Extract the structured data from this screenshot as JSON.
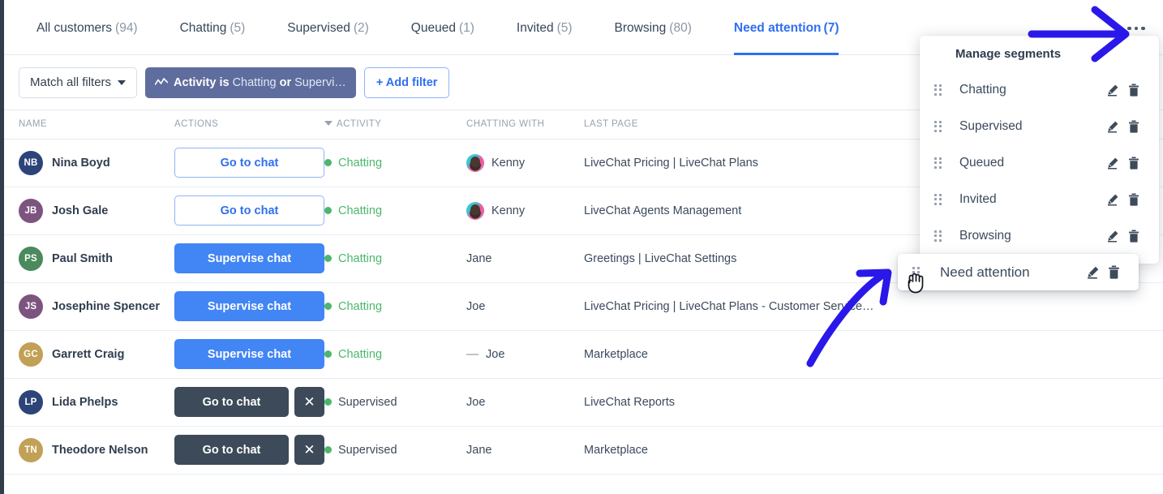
{
  "tabs": [
    {
      "label": "All customers",
      "count": "(94)",
      "active": false
    },
    {
      "label": "Chatting",
      "count": "(5)",
      "active": false
    },
    {
      "label": "Supervised",
      "count": "(2)",
      "active": false
    },
    {
      "label": "Queued",
      "count": "(1)",
      "active": false
    },
    {
      "label": "Invited",
      "count": "(5)",
      "active": false
    },
    {
      "label": "Browsing",
      "count": "(80)",
      "active": false
    },
    {
      "label": "Need attention",
      "count": "(7)",
      "active": true
    }
  ],
  "tabbar": {
    "more_icon": "kebab-more-icon"
  },
  "filters": {
    "match_label": "Match all filters",
    "chip_icon": "activity-line-icon",
    "chip_label": "Activity is",
    "chip_value": "Chatting",
    "chip_or": "or",
    "chip_value2": "Supervi…",
    "add_filter_label": "+ Add filter"
  },
  "table": {
    "headers": {
      "name": "NAME",
      "actions": "ACTIONS",
      "activity": "ACTIVITY",
      "chatting_with": "CHATTING WITH",
      "last_page": "LAST PAGE"
    },
    "sort_column": "ACTIVITY",
    "rows": [
      {
        "initials": "NB",
        "avatar_color": "#2d4479",
        "name": "Nina Boyd",
        "action": "Go to chat",
        "action_style": "outline",
        "has_close": false,
        "activity": "Chatting",
        "activity_state": "chatting",
        "agent": "Kenny",
        "agent_avatar": "photo",
        "agent_dash": false,
        "last_page": "LiveChat Pricing | LiveChat Plans"
      },
      {
        "initials": "JB",
        "avatar_color": "#7d5480",
        "name": "Josh Gale",
        "action": "Go to chat",
        "action_style": "outline",
        "has_close": false,
        "activity": "Chatting",
        "activity_state": "chatting",
        "agent": "Kenny",
        "agent_avatar": "photo",
        "agent_dash": false,
        "last_page": "LiveChat Agents Management"
      },
      {
        "initials": "PS",
        "avatar_color": "#4a8a5c",
        "name": "Paul Smith",
        "action": "Supervise chat",
        "action_style": "solid",
        "has_close": false,
        "activity": "Chatting",
        "activity_state": "chatting",
        "agent": "Jane",
        "agent_avatar": "none",
        "agent_dash": false,
        "last_page": "Greetings | LiveChat Settings"
      },
      {
        "initials": "JS",
        "avatar_color": "#7d5480",
        "name": "Josephine Spencer",
        "action": "Supervise chat",
        "action_style": "solid",
        "has_close": false,
        "activity": "Chatting",
        "activity_state": "chatting",
        "agent": "Joe",
        "agent_avatar": "none",
        "agent_dash": false,
        "last_page": "LiveChat Pricing | LiveChat Plans - Customer Service…"
      },
      {
        "initials": "GC",
        "avatar_color": "#c2a055",
        "name": "Garrett Craig",
        "action": "Supervise chat",
        "action_style": "solid",
        "has_close": false,
        "activity": "Chatting",
        "activity_state": "chatting",
        "agent": "Joe",
        "agent_avatar": "none",
        "agent_dash": true,
        "last_page": "Marketplace"
      },
      {
        "initials": "LP",
        "avatar_color": "#2d4479",
        "name": "Lida Phelps",
        "action": "Go to chat",
        "action_style": "dark",
        "has_close": true,
        "activity": "Supervised",
        "activity_state": "supervised",
        "agent": "Joe",
        "agent_avatar": "none",
        "agent_dash": false,
        "last_page": "LiveChat Reports"
      },
      {
        "initials": "TN",
        "avatar_color": "#c2a055",
        "name": "Theodore Nelson",
        "action": "Go to chat",
        "action_style": "dark",
        "has_close": true,
        "activity": "Supervised",
        "activity_state": "supervised",
        "agent": "Jane",
        "agent_avatar": "none",
        "agent_dash": false,
        "last_page": "Marketplace"
      }
    ],
    "close_label": "✕"
  },
  "dropdown": {
    "title": "Manage segments",
    "items": [
      {
        "label": "Chatting"
      },
      {
        "label": "Supervised"
      },
      {
        "label": "Queued"
      },
      {
        "label": "Invited"
      },
      {
        "label": "Browsing"
      }
    ],
    "dragged_item": {
      "label": "Need attention"
    }
  },
  "annotations": {
    "arrow_color": "#2a18e8",
    "arrow_top_target": "kebab-more-icon",
    "arrow_bottom_target": "dragged-segment-item"
  },
  "colors": {
    "accent_blue": "#2f6ff1",
    "button_blue": "#4285f4",
    "chip_purple": "#5f6d9e",
    "dark_button": "#3d4a59",
    "green_status": "#4bb76b",
    "rail_dark": "#313d4b"
  }
}
